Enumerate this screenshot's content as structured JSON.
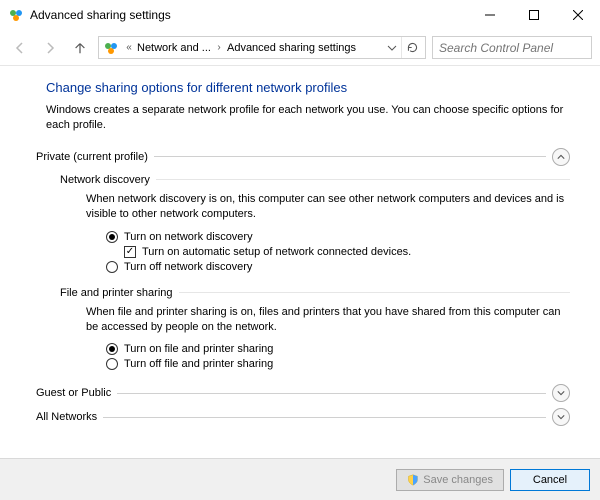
{
  "window": {
    "title": "Advanced sharing settings"
  },
  "breadcrumb": {
    "seg1": "Network and ...",
    "seg2": "Advanced sharing settings"
  },
  "search": {
    "placeholder": "Search Control Panel"
  },
  "page": {
    "heading": "Change sharing options for different network profiles",
    "description": "Windows creates a separate network profile for each network you use. You can choose specific options for each profile."
  },
  "sections": {
    "private": {
      "label": "Private (current profile)",
      "networkDiscovery": {
        "title": "Network discovery",
        "desc": "When network discovery is on, this computer can see other network computers and devices and is visible to other network computers.",
        "optOn": "Turn on network discovery",
        "chkAuto": "Turn on automatic setup of network connected devices.",
        "optOff": "Turn off network discovery"
      },
      "filePrinter": {
        "title": "File and printer sharing",
        "desc": "When file and printer sharing is on, files and printers that you have shared from this computer can be accessed by people on the network.",
        "optOn": "Turn on file and printer sharing",
        "optOff": "Turn off file and printer sharing"
      }
    },
    "guest": {
      "label": "Guest or Public"
    },
    "all": {
      "label": "All Networks"
    }
  },
  "footer": {
    "save": "Save changes",
    "cancel": "Cancel"
  }
}
